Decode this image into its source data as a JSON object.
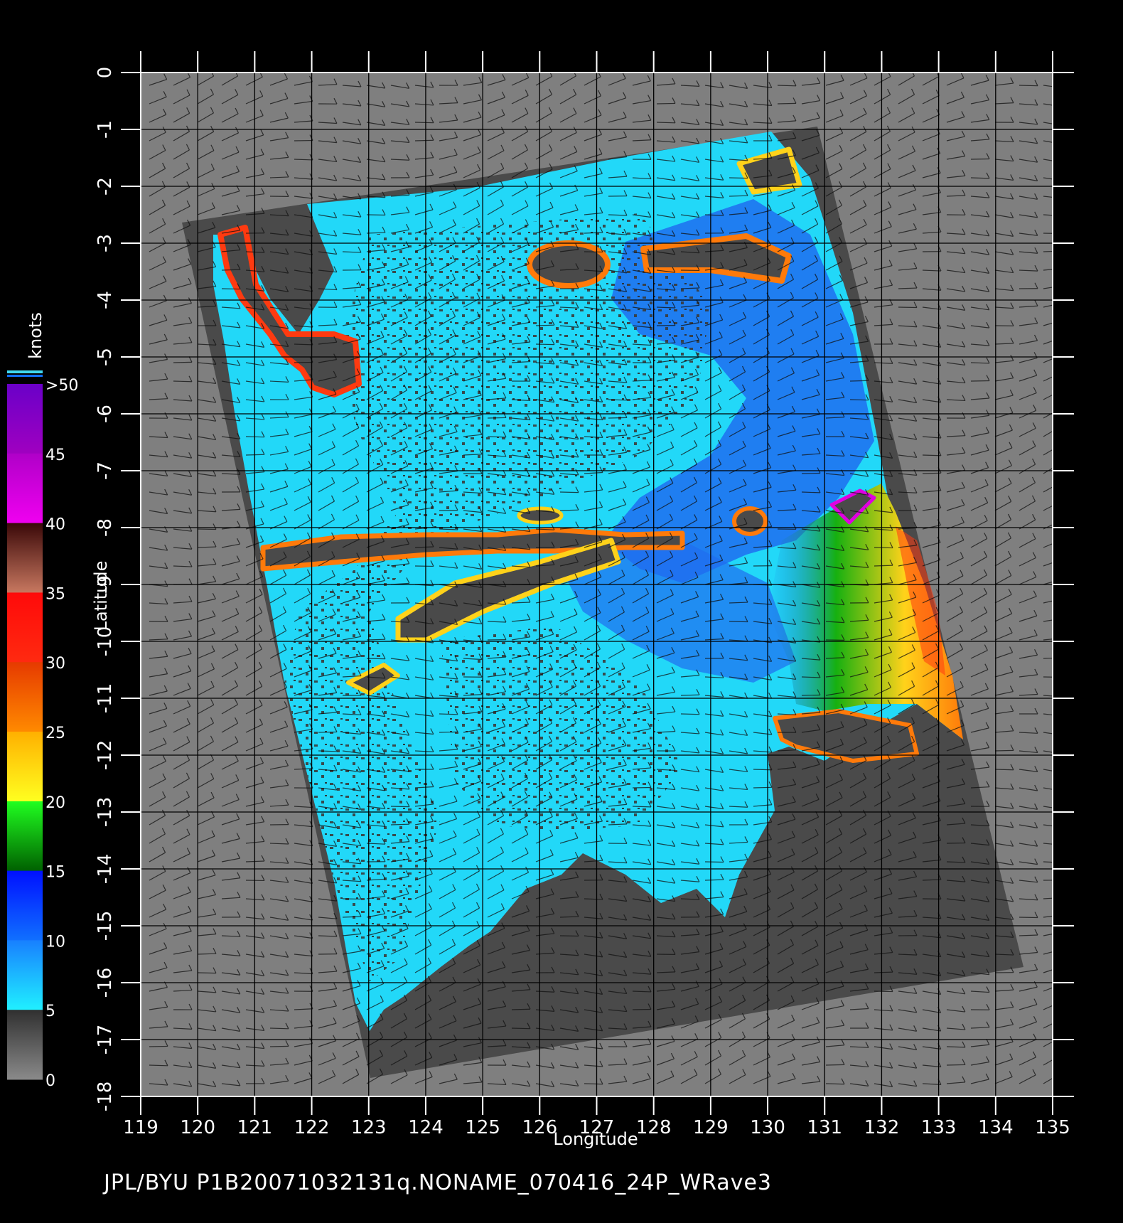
{
  "map": {
    "x_axis": {
      "label": "Longitude",
      "min": 119,
      "max": 135,
      "ticks": [
        119,
        120,
        121,
        122,
        123,
        124,
        125,
        126,
        127,
        128,
        129,
        130,
        131,
        132,
        133,
        134,
        135
      ]
    },
    "y_axis": {
      "label": "Latitude",
      "min": -18,
      "max": 0,
      "ticks": [
        0,
        -1,
        -2,
        -3,
        -4,
        -5,
        -6,
        -7,
        -8,
        -9,
        -10,
        -11,
        -12,
        -13,
        -14,
        -15,
        -16,
        -17,
        -18
      ]
    },
    "grid": true,
    "layer": "scatterometer wind speed with wind barbs",
    "colors": {
      "background": "#000000",
      "outside_swath": "#7f7f7f",
      "land": "#4a4a4a",
      "ocean_low": "#22d8f8",
      "ocean_mid": "#1f6ef0",
      "green": "#16b010",
      "yellow": "#ffd21a",
      "orange": "#ff7a0a",
      "red": "#ff1e0a",
      "magenta": "#e000e0",
      "purple": "#7a00c8"
    }
  },
  "colorbar": {
    "unit_label": "knots",
    "tick_labels": [
      ">50",
      "45",
      "40",
      "35",
      "30",
      "25",
      "20",
      "15",
      "10",
      "5",
      "0"
    ],
    "segments": [
      {
        "from": 50,
        "to": 45,
        "colors": [
          "#6a00c8",
          "#a000c0"
        ]
      },
      {
        "from": 45,
        "to": 40,
        "colors": [
          "#b000c8",
          "#f000f0"
        ]
      },
      {
        "from": 40,
        "to": 35,
        "colors": [
          "#3a0808",
          "#c87860"
        ]
      },
      {
        "from": 35,
        "to": 30,
        "colors": [
          "#ff0a0a",
          "#ff2a10"
        ]
      },
      {
        "from": 30,
        "to": 25,
        "colors": [
          "#e63a00",
          "#ff8a00"
        ]
      },
      {
        "from": 25,
        "to": 20,
        "colors": [
          "#ffb000",
          "#ffff20"
        ]
      },
      {
        "from": 20,
        "to": 15,
        "colors": [
          "#20ff20",
          "#006000"
        ]
      },
      {
        "from": 15,
        "to": 10,
        "colors": [
          "#0010ff",
          "#1070ff"
        ]
      },
      {
        "from": 10,
        "to": 5,
        "colors": [
          "#1880ff",
          "#20f0ff"
        ]
      },
      {
        "from": 5,
        "to": 0,
        "colors": [
          "#303030",
          "#8a8a8a"
        ]
      }
    ]
  },
  "footer": {
    "caption": "JPL/BYU  P1B20071032131q.NONAME_070416_24P_WRave3"
  }
}
